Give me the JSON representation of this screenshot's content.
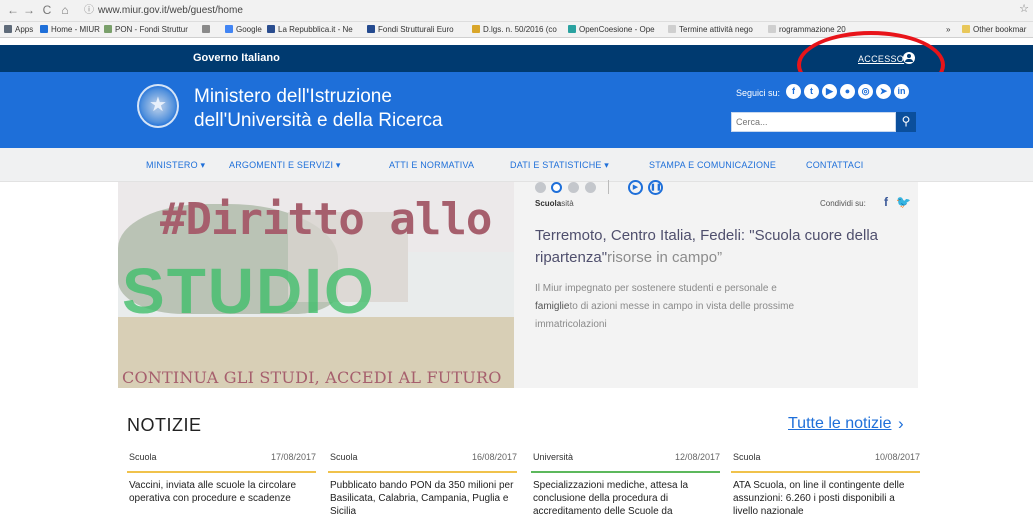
{
  "browser": {
    "address": "www.miur.gov.it/web/guest/home",
    "bookmarks": [
      {
        "label": "Apps",
        "color": "#5f6b7a"
      },
      {
        "label": "Home - MIUR",
        "color": "#1e6fd9"
      },
      {
        "label": "PON - Fondi Struttur",
        "color": "#7aa06b"
      },
      {
        "label": "Google",
        "color": "#4285f4"
      },
      {
        "label": "La Repubblica.it - Ne",
        "color": "#2a4d8f"
      },
      {
        "label": "Fondi Strutturali Euro",
        "color": "#244a8f"
      },
      {
        "label": "D.lgs. n. 50/2016 (co",
        "color": "#d9a62a"
      },
      {
        "label": "OpenCoesione - Ope",
        "color": "#2aa2a0"
      },
      {
        "label": "Termine attività nego",
        "color": "#999999"
      },
      {
        "label": "rogrammazione 20",
        "color": "#999999"
      },
      {
        "label": "»",
        "color": ""
      },
      {
        "label": "Other bookmar",
        "color": "#e8c75a"
      }
    ]
  },
  "gov_bar": {
    "title": "Governo Italiano",
    "login": "ACCESSO"
  },
  "header": {
    "line1": "Ministero dell'Istruzione",
    "line2": "dell'Università e della Ricerca",
    "follow": "Seguici su:",
    "search_placeholder": "Cerca..."
  },
  "nav": [
    "MINISTERO  ▾",
    "ARGOMENTI E SERVIZI  ▾",
    "ATTI E NORMATIVA",
    "DATI E STATISTICHE  ▾",
    "STAMPA E COMUNICAZIONE",
    "CONTATTACI"
  ],
  "hero": {
    "image_title": "#Diritto allo",
    "image_word": "STUDIO",
    "image_sub": "CONTINUA GLI STUDI, ACCEDI AL FUTURO",
    "category": "Scuola",
    "category_ghost": "sità",
    "share": "Condividi su:",
    "title_line1": "Terremoto, Centro Italia, Fedeli: \"Scuola cuore della",
    "title_line2_a": "ripartenza\"",
    "title_line2_b": "risorse in campo”",
    "desc_line1": "Il Miur impegnato per sostenere studenti e personale e",
    "desc_line2": "famiglie",
    "desc_line2_b": "to di azioni messe in campo in vista delle prossime",
    "desc_line3": "immatricolazioni"
  },
  "news": {
    "heading": "NOTIZIE",
    "all_link": "Tutte le notizie",
    "items": [
      {
        "category": "Scuola",
        "date": "17/08/2017",
        "text": "Vaccini, inviata alle scuole la circolare operativa con procedure e scadenze",
        "color": "#f0c24b"
      },
      {
        "category": "Scuola",
        "date": "16/08/2017",
        "text": "Pubblicato bando PON da 350 milioni per Basilicata, Calabria, Campania, Puglia e Sicilia",
        "color": "#f0c24b"
      },
      {
        "category": "Università",
        "date": "12/08/2017",
        "text": "Specializzazioni mediche, attesa la conclusione della procedura di accreditamento delle Scuole da",
        "color": "#5cb85c"
      },
      {
        "category": "Scuola",
        "date": "10/08/2017",
        "text": "ATA Scuola, on line il contingente delle assunzioni: 6.260 i posti disponibili a livello nazionale",
        "color": "#f0c24b"
      }
    ]
  }
}
